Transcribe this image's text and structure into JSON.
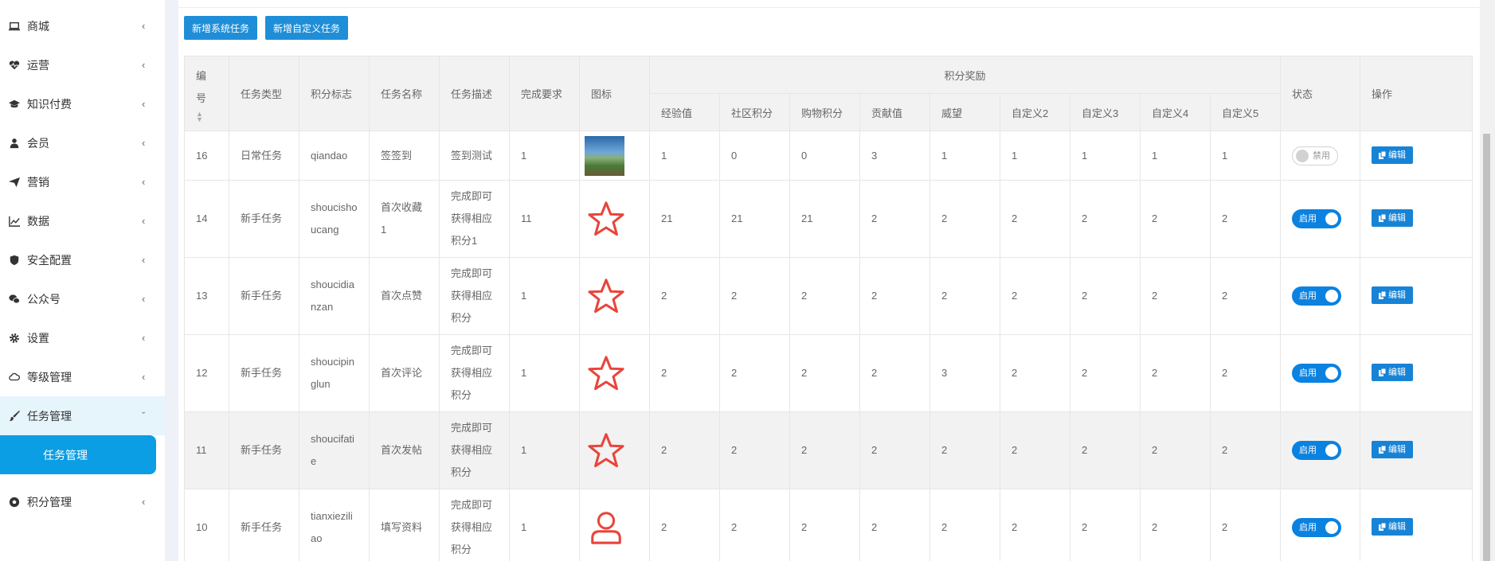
{
  "sidebar": {
    "items": [
      {
        "label": "商城",
        "icon": "laptop-icon"
      },
      {
        "label": "运营",
        "icon": "heartbeat-icon"
      },
      {
        "label": "知识付费",
        "icon": "graduation-cap-icon"
      },
      {
        "label": "会员",
        "icon": "user-icon"
      },
      {
        "label": "营销",
        "icon": "paper-plane-icon"
      },
      {
        "label": "数据",
        "icon": "line-chart-icon"
      },
      {
        "label": "安全配置",
        "icon": "shield-icon"
      },
      {
        "label": "公众号",
        "icon": "wechat-icon"
      },
      {
        "label": "设置",
        "icon": "gear-icon"
      },
      {
        "label": "等级管理",
        "icon": "cloud-icon"
      },
      {
        "label": "任务管理",
        "icon": "brush-icon"
      },
      {
        "label": "积分管理",
        "icon": "soccer-ball-icon"
      }
    ],
    "active_sub": "任务管理",
    "caret_collapsed": "‹",
    "caret_expanded": "ˇ"
  },
  "toolbar": {
    "add_system_task": "新增系统任务",
    "add_custom_task": "新增自定义任务"
  },
  "table": {
    "headers": {
      "id": "编号",
      "type": "任务类型",
      "flag": "积分标志",
      "name": "任务名称",
      "desc": "任务描述",
      "req": "完成要求",
      "icon": "图标",
      "reward_group": "积分奖励",
      "status": "状态",
      "action": "操作"
    },
    "reward_headers": [
      "经验值",
      "社区积分",
      "购物积分",
      "贡献值",
      "威望",
      "自定义2",
      "自定义3",
      "自定义4",
      "自定义5"
    ],
    "status_on": "启用",
    "status_off": "禁用",
    "edit_label": "编辑",
    "rows": [
      {
        "id": "16",
        "type": "日常任务",
        "flag": "qiandao",
        "name": "签签到",
        "desc": "签到测试",
        "req": "1",
        "icon": "image",
        "rewards": [
          "1",
          "0",
          "0",
          "3",
          "1",
          "1",
          "1",
          "1",
          "1"
        ],
        "enabled": false
      },
      {
        "id": "14",
        "type": "新手任务",
        "flag": "shoucishoucang",
        "name": "首次收藏1",
        "desc": "完成即可获得相应积分1",
        "req": "11",
        "icon": "star",
        "rewards": [
          "21",
          "21",
          "21",
          "2",
          "2",
          "2",
          "2",
          "2",
          "2"
        ],
        "enabled": true
      },
      {
        "id": "13",
        "type": "新手任务",
        "flag": "shoucidianzan",
        "name": "首次点赞",
        "desc": "完成即可获得相应积分",
        "req": "1",
        "icon": "star",
        "rewards": [
          "2",
          "2",
          "2",
          "2",
          "2",
          "2",
          "2",
          "2",
          "2"
        ],
        "enabled": true
      },
      {
        "id": "12",
        "type": "新手任务",
        "flag": "shoucipinglun",
        "name": "首次评论",
        "desc": "完成即可获得相应积分",
        "req": "1",
        "icon": "star",
        "rewards": [
          "2",
          "2",
          "2",
          "2",
          "3",
          "2",
          "2",
          "2",
          "2"
        ],
        "enabled": true
      },
      {
        "id": "11",
        "type": "新手任务",
        "flag": "shoucifatie",
        "name": "首次发帖",
        "desc": "完成即可获得相应积分",
        "req": "1",
        "icon": "star",
        "rewards": [
          "2",
          "2",
          "2",
          "2",
          "2",
          "2",
          "2",
          "2",
          "2"
        ],
        "enabled": true
      },
      {
        "id": "10",
        "type": "新手任务",
        "flag": "tianxieziliao",
        "name": "填写资料",
        "desc": "完成即可获得相应积分",
        "req": "1",
        "icon": "user",
        "rewards": [
          "2",
          "2",
          "2",
          "2",
          "2",
          "2",
          "2",
          "2",
          "2"
        ],
        "enabled": true
      }
    ]
  },
  "colors": {
    "primary": "#1f8ed8",
    "active_nav": "#0b9ee4",
    "icon_red": "#e8453c"
  }
}
